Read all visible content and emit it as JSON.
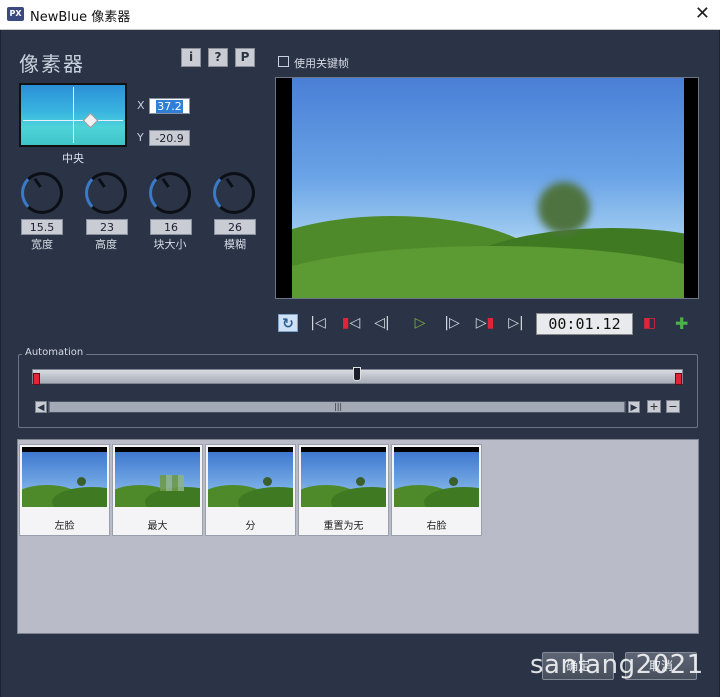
{
  "window": {
    "app_icon": "PX",
    "title": "NewBlue 像素器",
    "close": "✕"
  },
  "effect": {
    "title": "像素器",
    "info_btn": "i",
    "help_btn": "?",
    "preset_btn": "P"
  },
  "position": {
    "label": "中央",
    "x_label": "X",
    "x_value": "37.2",
    "y_label": "Y",
    "y_value": "-20.9"
  },
  "knobs": [
    {
      "value": "15.5",
      "label": "宽度"
    },
    {
      "value": "23",
      "label": "高度"
    },
    {
      "value": "16",
      "label": "块大小"
    },
    {
      "value": "26",
      "label": "模糊"
    }
  ],
  "keyframe": {
    "label": "使用关键帧",
    "checked": false
  },
  "transport": {
    "timecode": "00:01.12"
  },
  "automation": {
    "label": "Automation",
    "playhead_fraction": 0.5
  },
  "presets": [
    {
      "label": "左脸"
    },
    {
      "label": "最大"
    },
    {
      "label": "分"
    },
    {
      "label": "重置为无"
    },
    {
      "label": "右脸"
    }
  ],
  "footer": {
    "ok": "确定",
    "cancel": "取消",
    "watermark": "sanlang2021"
  }
}
